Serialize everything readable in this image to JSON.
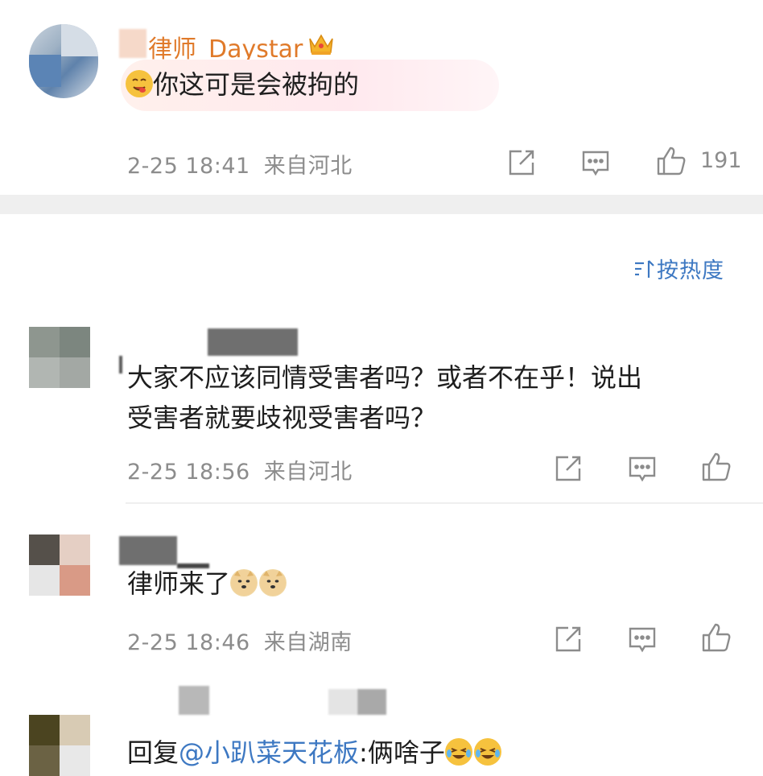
{
  "comments": [
    {
      "username_suffix": "律师_Daystar",
      "badge_icon": "crown-icon",
      "content": "你这可是会被拘的",
      "emoji_icon": "yum-face-icon",
      "time": "2-25 18:41",
      "location": "来自河北",
      "likes": "191"
    },
    {
      "content_line1": "大家不应该同情受害者吗？或者不在乎！说出",
      "content_line2": "受害者就要歧视受害者吗？",
      "time": "2-25 18:56",
      "location": "来自河北"
    },
    {
      "content": "律师来了",
      "emoji_icon": "doge-icon",
      "time": "2-25 18:46",
      "location": "来自湖南"
    },
    {
      "reply_prefix": "回复",
      "mention": "@小趴菜天花板",
      "content": ":俩啥子",
      "emoji_icon": "laughing-crying-icon"
    }
  ],
  "sort": {
    "label": "按热度",
    "icon": "sort-icon"
  },
  "icons": {
    "share": "share-icon",
    "comment": "comment-icon",
    "like": "like-icon"
  },
  "colors": {
    "username": "#e07a2a",
    "meta": "#8c8c8c",
    "sort": "#3d78c2",
    "mention": "#3d78c2",
    "divider": "#efefef"
  }
}
